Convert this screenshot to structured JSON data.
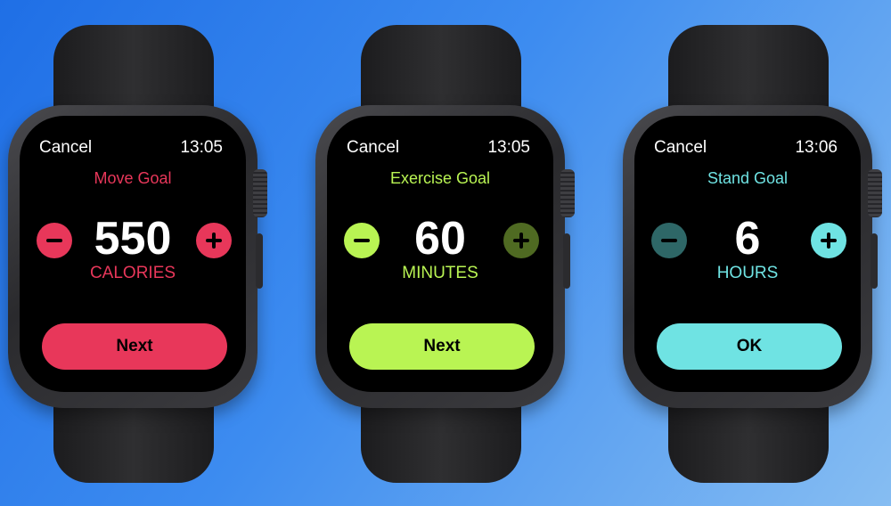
{
  "background": {
    "gradient_start": "#1f6fe6",
    "gradient_end": "#86bdf2"
  },
  "watches": [
    {
      "cancel_label": "Cancel",
      "time": "13:05",
      "goal_label": "Move Goal",
      "value": "550",
      "unit": "CALORIES",
      "action_label": "Next",
      "accent": "#e8375a",
      "minus_color": "#e8375a",
      "plus_color": "#e8375a",
      "minus_icon": "minus-icon",
      "plus_icon": "plus-icon"
    },
    {
      "cancel_label": "Cancel",
      "time": "13:05",
      "goal_label": "Exercise Goal",
      "value": "60",
      "unit": "MINUTES",
      "action_label": "Next",
      "accent": "#b9f453",
      "minus_color": "#b9f453",
      "plus_color": "#4f6a22",
      "minus_icon": "minus-icon",
      "plus_icon": "plus-icon"
    },
    {
      "cancel_label": "Cancel",
      "time": "13:06",
      "goal_label": "Stand Goal",
      "value": "6",
      "unit": "HOURS",
      "action_label": "OK",
      "accent": "#6fe3e3",
      "minus_color": "#2e6767",
      "plus_color": "#6fe3e3",
      "minus_icon": "minus-icon",
      "plus_icon": "plus-icon"
    }
  ]
}
